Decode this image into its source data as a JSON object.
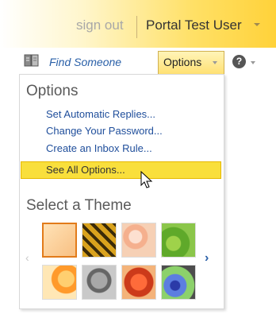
{
  "header": {
    "sign_out_label": "sign out",
    "user_name": "Portal Test User"
  },
  "toolbar": {
    "find_someone_label": "Find Someone",
    "options_label": "Options",
    "help_glyph": "?"
  },
  "options_menu": {
    "heading": "Options",
    "items": [
      {
        "label": "Set Automatic Replies..."
      },
      {
        "label": "Change Your Password..."
      },
      {
        "label": "Create an Inbox Rule..."
      }
    ],
    "see_all_label": "See All Options...",
    "theme_heading": "Select a Theme",
    "nav_prev": "‹",
    "nav_next": "›",
    "themes": [
      {
        "name": "theme-plain-peach",
        "selected": true
      },
      {
        "name": "theme-tiger-stripes",
        "selected": false
      },
      {
        "name": "theme-pink-flowers",
        "selected": false
      },
      {
        "name": "theme-green-leaves",
        "selected": false
      },
      {
        "name": "theme-orange-swirl",
        "selected": false
      },
      {
        "name": "theme-robot",
        "selected": false
      },
      {
        "name": "theme-red-mask",
        "selected": false
      },
      {
        "name": "theme-monsters",
        "selected": false
      }
    ]
  },
  "colors": {
    "accent_yellow": "#ffd23a",
    "highlight": "#f9df3c",
    "link_blue": "#1f4e9b",
    "selected_border": "#e27b1a"
  }
}
